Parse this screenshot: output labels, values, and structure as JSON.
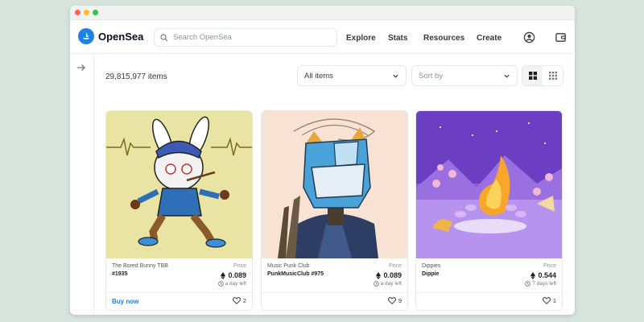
{
  "window": {
    "dots": [
      "#ff5f57",
      "#ffbd2e",
      "#28c840"
    ]
  },
  "header": {
    "brand": "OpenSea",
    "search_placeholder": "Search OpenSea",
    "nav": [
      "Explore",
      "Stats",
      "Resources",
      "Create"
    ],
    "icons": [
      "account-icon",
      "wallet-icon"
    ]
  },
  "toolbar": {
    "count": "29,815,977 items",
    "filter": "All items",
    "sort": "Sort by",
    "views": [
      "large-grid-icon",
      "small-grid-icon"
    ]
  },
  "colors": {
    "accent": "#2081e2",
    "card1_bg": "#e9e4a4",
    "card2_bg": "#f7e2d3",
    "card3_bg": "#8b5fd6"
  },
  "cards": [
    {
      "collection": "The Bored Bunny TBB",
      "name": "#1935",
      "price_label": "Price",
      "price": "0.089",
      "time": "a day left",
      "action": "Buy now",
      "likes": "2"
    },
    {
      "collection": "Music Punk Club",
      "name": "PunkMusicClub #975",
      "price_label": "Price",
      "price": "0.089",
      "time": "a day left",
      "action": "",
      "likes": "9"
    },
    {
      "collection": "Dippies",
      "name": "Dippie",
      "price_label": "Price",
      "price": "0.544",
      "time": "7 days left",
      "action": "",
      "likes": "1"
    }
  ]
}
